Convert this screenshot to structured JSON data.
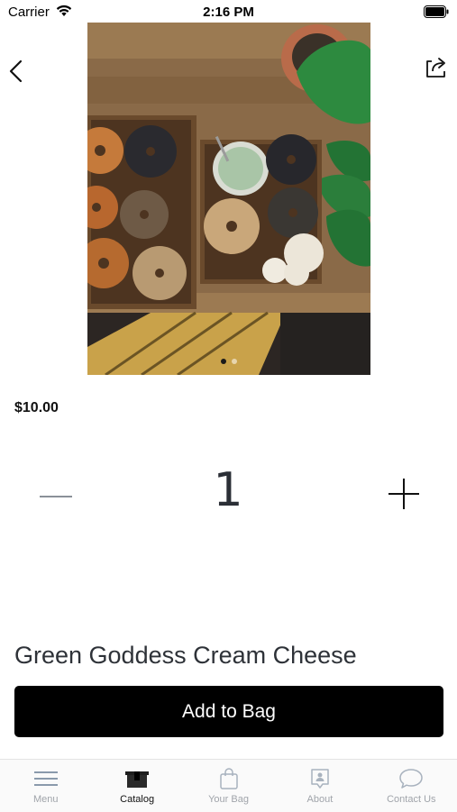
{
  "status_bar": {
    "carrier": "Carrier",
    "time": "2:16 PM"
  },
  "product": {
    "price": "$10.00",
    "quantity": "1",
    "title": "Green Goddess Cream Cheese",
    "image_count": 2,
    "image_active_index": 0
  },
  "actions": {
    "add_label": "Add to Bag"
  },
  "tabs": [
    {
      "label": "Menu",
      "icon": "menu-icon",
      "active": false
    },
    {
      "label": "Catalog",
      "icon": "catalog-icon",
      "active": true
    },
    {
      "label": "Your Bag",
      "icon": "bag-icon",
      "active": false
    },
    {
      "label": "About",
      "icon": "about-icon",
      "active": false
    },
    {
      "label": "Contact Us",
      "icon": "chat-icon",
      "active": false
    }
  ],
  "colors": {
    "primary_button": "#000000",
    "active_tab": "#111111",
    "inactive_tab": "#a0a4aa"
  }
}
